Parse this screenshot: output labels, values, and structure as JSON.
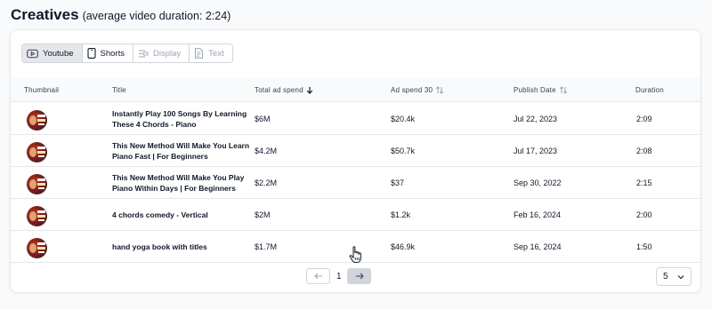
{
  "header": {
    "title": "Creatives",
    "subtitle": "(average video duration: 2:24)"
  },
  "tabs": [
    {
      "label": "Youtube",
      "icon": "youtube-icon",
      "state": "active"
    },
    {
      "label": "Shorts",
      "icon": "phone-icon",
      "state": "normal"
    },
    {
      "label": "Display",
      "icon": "display-icon",
      "state": "disabled"
    },
    {
      "label": "Text",
      "icon": "text-doc-icon",
      "state": "disabled"
    }
  ],
  "columns": {
    "thumbnail": "Thumbnail",
    "title": "Title",
    "total_ad_spend": "Total ad spend",
    "ad_spend_30": "Ad spend 30",
    "publish_date": "Publish Date",
    "duration": "Duration"
  },
  "rows": [
    {
      "title": "Instantly Play 100 Songs By Learning These 4 Chords - Piano",
      "total": "$6M",
      "spend30": "$20.4k",
      "date": "Jul 22, 2023",
      "duration": "2:09"
    },
    {
      "title": "This New Method Will Make You Learn Piano Fast | For Beginners",
      "total": "$4.2M",
      "spend30": "$50.7k",
      "date": "Jul 17, 2023",
      "duration": "2:08"
    },
    {
      "title": "This New Method Will Make You Play Piano Within Days | For Beginners",
      "total": "$2.2M",
      "spend30": "$37",
      "date": "Sep 30, 2022",
      "duration": "2:15"
    },
    {
      "title": "4 chords comedy - Vertical",
      "total": "$2M",
      "spend30": "$1.2k",
      "date": "Feb 16, 2024",
      "duration": "2:00"
    },
    {
      "title": "hand yoga book with titles",
      "total": "$1.7M",
      "spend30": "$46.9k",
      "date": "Sep 16, 2024",
      "duration": "1:50"
    }
  ],
  "pagination": {
    "current_page": "1",
    "page_size": "5"
  },
  "colors": {
    "active_tab_bg": "#e5e7eb",
    "border": "#d1d5db",
    "header_row_bg": "#f9fafb",
    "next_button_bg": "#d1d5db"
  }
}
